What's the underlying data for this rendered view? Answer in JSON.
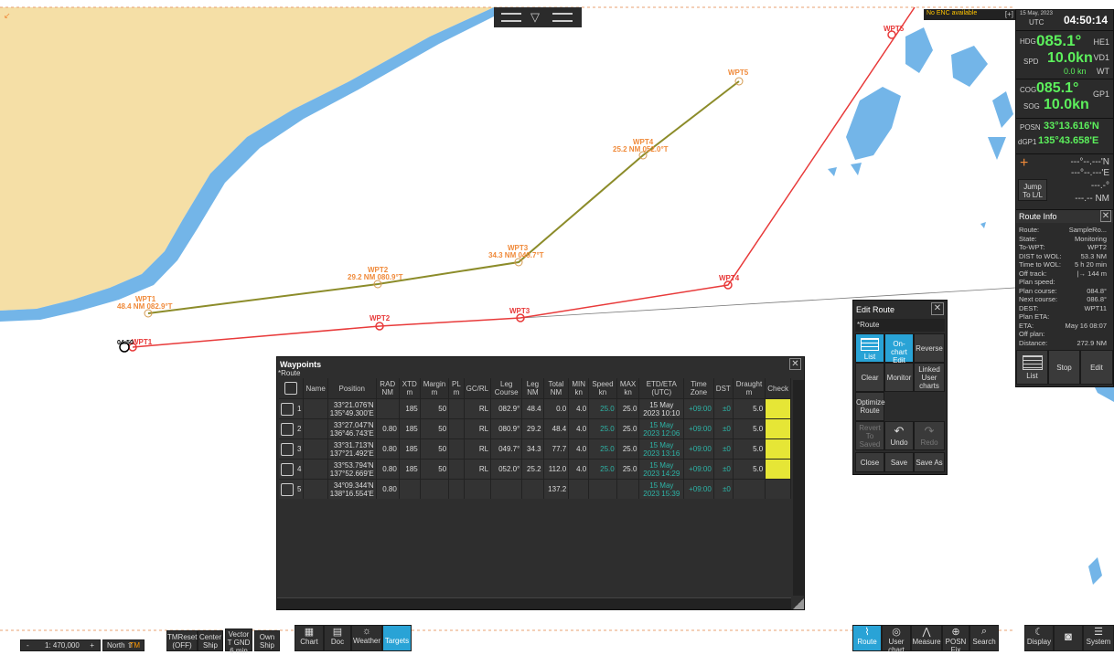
{
  "top_status": {
    "enc_warning": "No ENC available",
    "bracket": "[+]",
    "date": "15 May, 2023",
    "utc_label": "UTC",
    "time": "04:50:14"
  },
  "nav": {
    "hdg_label": "HDG",
    "hdg_value": "085.1°",
    "hdg_src": "HE1",
    "spd_label": "SPD",
    "spd_value": "10.0kn",
    "spd_src": "VD1",
    "spd_sub": "0.0 kn",
    "spd_sub_src": "WT",
    "cog_label": "COG",
    "cog_value": "085.1°",
    "cog_src": "GP1",
    "sog_label": "SOG",
    "sog_value": "10.0kn",
    "posn_label": "POSN",
    "posn_lat": "33°13.616'N",
    "posn_src": "dGP1",
    "posn_lon": "135°43.658'E",
    "cursor_lat": "---°--.---'N",
    "cursor_lon": "---°--.---'E",
    "cursor_brg": "---.-°",
    "cursor_dist": "---.-- NM",
    "jump_label": "Jump To L/L"
  },
  "route_info": {
    "title": "Route Info",
    "rows": [
      {
        "k": "Route:",
        "v": "SampleRo..."
      },
      {
        "k": "State:",
        "v": "Monitoring"
      },
      {
        "k": "To-WPT:",
        "v": "WPT2"
      },
      {
        "k": "DIST to WOL:",
        "v": "53.3 NM"
      },
      {
        "k": "Time to WOL:",
        "v": "5 h 20 min"
      },
      {
        "k": "Off track:",
        "v": "|→ 144 m"
      },
      {
        "k": "Plan speed:",
        "v": ""
      },
      {
        "k": "Plan course:",
        "v": "084.8°"
      },
      {
        "k": "Next course:",
        "v": "086.8°"
      },
      {
        "k": "DEST:",
        "v": "WPT11"
      },
      {
        "k": "Plan ETA:",
        "v": ""
      },
      {
        "k": "ETA:",
        "v": "May 16 08:07"
      },
      {
        "k": "Off plan:",
        "v": ""
      },
      {
        "k": "Distance:",
        "v": "272.9 NM"
      }
    ],
    "list_btn": "List",
    "stop_btn": "Stop",
    "edit_btn": "Edit"
  },
  "edit_route": {
    "title": "Edit Route",
    "route_name": "*Route",
    "list": "List",
    "onchart": "On-chart Edit",
    "reverse": "Reverse",
    "clear": "Clear",
    "monitor": "Monitor",
    "linked": "Linked User charts",
    "optimize": "Optimize Route",
    "revert": "Revert To Saved",
    "undo": "Undo",
    "redo": "Redo",
    "close": "Close",
    "save": "Save",
    "save_as": "Save As"
  },
  "waypoints": {
    "title": "Waypoints",
    "route_name": "*Route",
    "headers": [
      "",
      "Name",
      "Position",
      "RAD NM",
      "XTD m",
      "Margin m",
      "PL m",
      "GC/RL",
      "Leg Course",
      "Leg NM",
      "Total NM",
      "MIN kn",
      "Speed kn",
      "MAX kn",
      "ETD/ETA (UTC)",
      "Time Zone",
      "DST",
      "Draught m",
      "Check"
    ],
    "rows": [
      {
        "n": "1",
        "lat": "33°21.076'N",
        "lon": "135°49.300'E",
        "rad": "",
        "xtd": "185",
        "mar": "50",
        "pl": "",
        "gc": "RL",
        "crs": "082.9°",
        "leg": "48.4",
        "tot": "0.0",
        "min": "4.0",
        "spd": "25.0",
        "max": "25.0",
        "eta1": "15 May",
        "eta2": "2023 10:10",
        "tz": "+09:00",
        "dst": "±0",
        "dr": "5.0"
      },
      {
        "n": "2",
        "lat": "33°27.047'N",
        "lon": "136°46.743'E",
        "rad": "0.80",
        "xtd": "185",
        "mar": "50",
        "pl": "",
        "gc": "RL",
        "crs": "080.9°",
        "leg": "29.2",
        "tot": "48.4",
        "min": "4.0",
        "spd": "25.0",
        "max": "25.0",
        "eta1": "15 May",
        "eta2": "2023 12:06",
        "tz": "+09:00",
        "dst": "±0",
        "dr": "5.0"
      },
      {
        "n": "3",
        "lat": "33°31.713'N",
        "lon": "137°21.492'E",
        "rad": "0.80",
        "xtd": "185",
        "mar": "50",
        "pl": "",
        "gc": "RL",
        "crs": "049.7°",
        "leg": "34.3",
        "tot": "77.7",
        "min": "4.0",
        "spd": "25.0",
        "max": "25.0",
        "eta1": "15 May",
        "eta2": "2023 13:16",
        "tz": "+09:00",
        "dst": "±0",
        "dr": "5.0"
      },
      {
        "n": "4",
        "lat": "33°53.794'N",
        "lon": "137°52.669'E",
        "rad": "0.80",
        "xtd": "185",
        "mar": "50",
        "pl": "",
        "gc": "RL",
        "crs": "052.0°",
        "leg": "25.2",
        "tot": "112.0",
        "min": "4.0",
        "spd": "25.0",
        "max": "25.0",
        "eta1": "15 May",
        "eta2": "2023 14:29",
        "tz": "+09:00",
        "dst": "±0",
        "dr": "5.0"
      },
      {
        "n": "5",
        "lat": "34°09.344'N",
        "lon": "138°16.554'E",
        "rad": "0.80",
        "xtd": "",
        "mar": "",
        "pl": "",
        "gc": "",
        "crs": "",
        "leg": "",
        "tot": "137.2",
        "min": "",
        "spd": "",
        "max": "",
        "eta1": "15 May",
        "eta2": "2023 15:39",
        "tz": "+09:00",
        "dst": "±0",
        "dr": ""
      }
    ]
  },
  "map_labels": {
    "wpt1": "WPT1",
    "wpt1_leg": "48.4 NM 082.9°T",
    "wpt2": "WPT2",
    "wpt2_leg": "29.2 NM 080.9°T",
    "wpt3": "WPT3",
    "wpt3_leg": "34.3 NM 049.7°T",
    "wpt4": "WPT4",
    "wpt4_leg": "25.2 NM 052.0°T",
    "wpt5": "WPT5",
    "r_wpt1": "WPT1",
    "r_wpt2": "WPT2",
    "r_wpt3": "WPT3",
    "r_wpt4": "WPT4",
    "r_wpt5": "WPT5",
    "own_ship": "04:50"
  },
  "bottom": {
    "scale_minus": "-",
    "scale": "1: 470,000",
    "scale_plus": "+",
    "north": "North ⇧",
    "tm": "TM",
    "tm_reset": "TMReset (OFF)",
    "center": "Center Ship",
    "vector": "Vector T GND 6 min",
    "own": "Own Ship",
    "chart": "Chart",
    "doc": "Doc",
    "weather": "Weather",
    "targets": "Targets",
    "route": "Route",
    "user_chart": "User chart",
    "measure": "Measure",
    "posn_fix": "POSN Fix",
    "search": "Search",
    "display": "Display",
    "camera": "",
    "system": "System"
  },
  "colors": {
    "sea": "#ffffff",
    "land": "#f5dfa6",
    "shallow": "#73b5e8",
    "planned_route": "#8c8c2a",
    "active_route": "#e83a3a",
    "label": "#f08a3a",
    "accent": "#29a3d6"
  }
}
